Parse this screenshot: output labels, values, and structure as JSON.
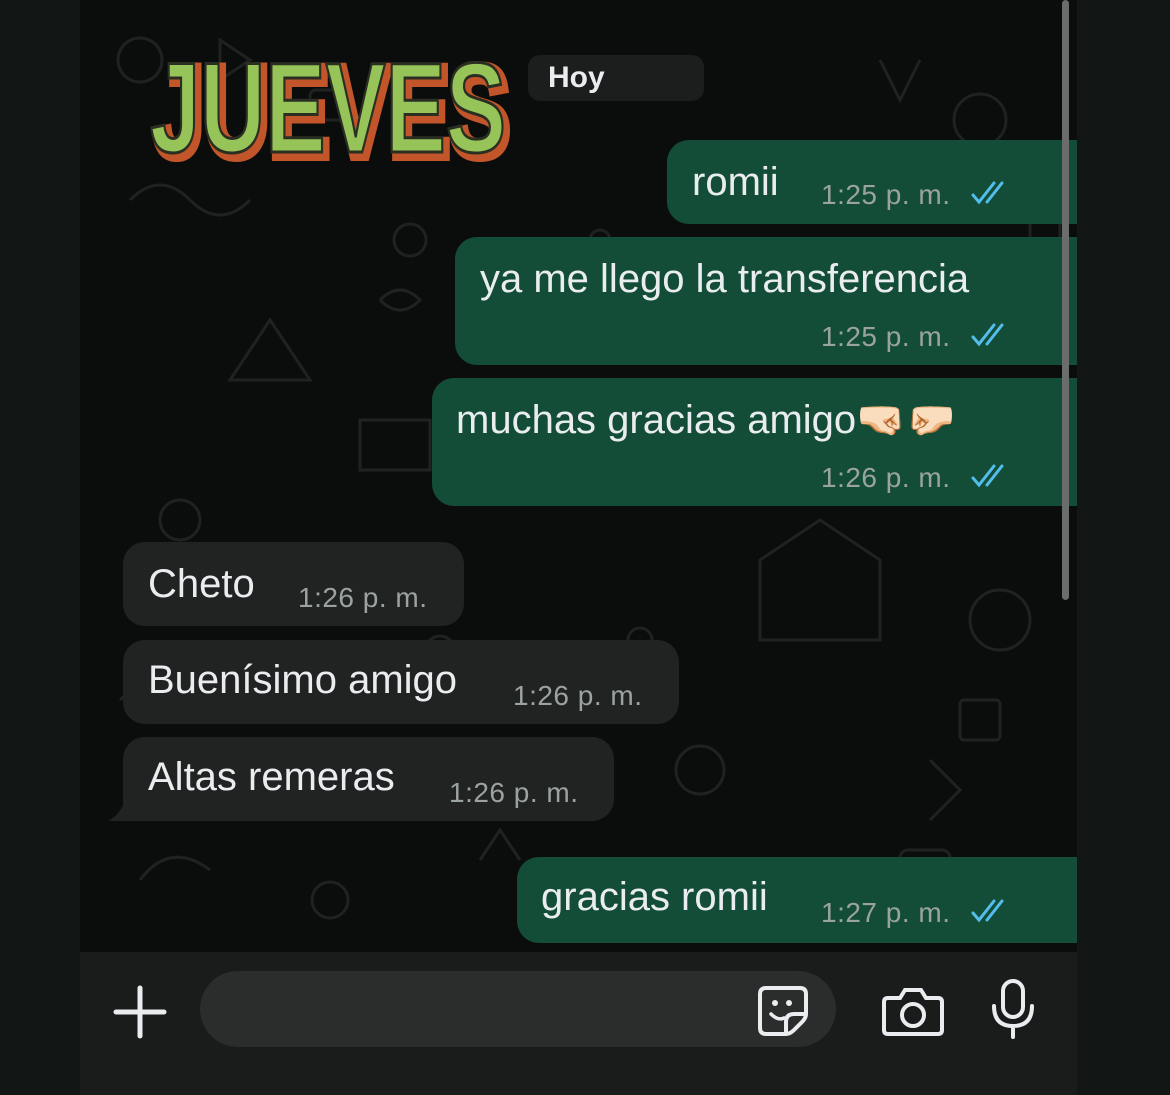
{
  "chat": {
    "date_label": "Hoy",
    "sticker_text": "JUEVES",
    "messages": [
      {
        "direction": "out",
        "text": "romii",
        "time": "1:25 p. m.",
        "status": "read"
      },
      {
        "direction": "out",
        "text": "ya me llego la transferencia",
        "time": "1:25 p. m.",
        "status": "read"
      },
      {
        "direction": "out",
        "text": "muchas gracias amigo🤜🏻🤛🏻",
        "time": "1:26 p. m.",
        "status": "read"
      },
      {
        "direction": "in",
        "text": "Cheto",
        "time": "1:26 p. m."
      },
      {
        "direction": "in",
        "text": "Buenísimo amigo",
        "time": "1:26 p. m."
      },
      {
        "direction": "in",
        "text": "Altas remeras",
        "time": "1:26 p. m."
      },
      {
        "direction": "out",
        "text": "gracias romii",
        "time": "1:27 p. m.",
        "status": "read"
      }
    ]
  },
  "composer": {
    "placeholder": "",
    "icons": [
      "plus-icon",
      "sticker-icon",
      "camera-icon",
      "microphone-icon"
    ]
  },
  "colors": {
    "outgoing_bubble": "#144d37",
    "incoming_bubble": "#212322",
    "read_ticks": "#53bdeb",
    "sticker_green": "#97c459",
    "sticker_orange": "#c2552a"
  }
}
